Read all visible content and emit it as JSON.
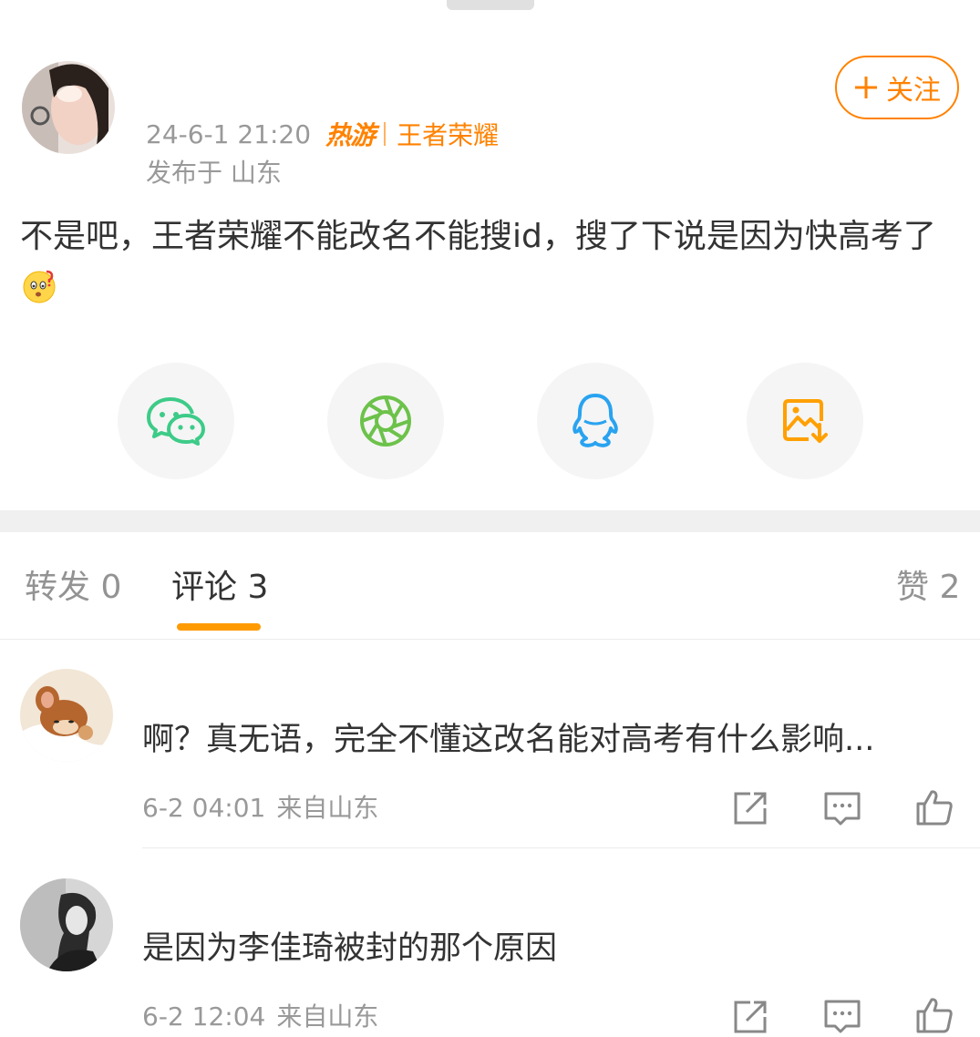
{
  "post": {
    "author_name": "",
    "time": "24-6-1 21:20",
    "hot_badge": "热游",
    "topic": "王者荣耀",
    "location": "发布于 山东",
    "text": "不是吧，王者荣耀不能改名不能搜id，搜了下说是因为快高考了",
    "follow_label": "关注",
    "follow_icon": "plus-icon"
  },
  "share": {
    "items": [
      {
        "icon": "wechat-icon",
        "color": "#3dcb88"
      },
      {
        "icon": "moments-icon",
        "color": "#6cc24a"
      },
      {
        "icon": "qq-icon",
        "color": "#29a3f0"
      },
      {
        "icon": "save-image-icon",
        "color": "#ffa000"
      }
    ]
  },
  "tabs": {
    "repost": "转发 0",
    "comments": "评论 3",
    "likes": "赞 2"
  },
  "colors": {
    "accent": "#ff8200",
    "tab_indicator": "#ff9a00",
    "secondary_text": "#999999"
  },
  "comments": [
    {
      "text": "啊？真无语，完全不懂这改名能对高考有什么影响...",
      "time": "6-2 04:01",
      "source": "来自山东"
    },
    {
      "text": "是因为李佳琦被封的那个原因",
      "time": "6-2 12:04",
      "source": "来自山东"
    }
  ]
}
